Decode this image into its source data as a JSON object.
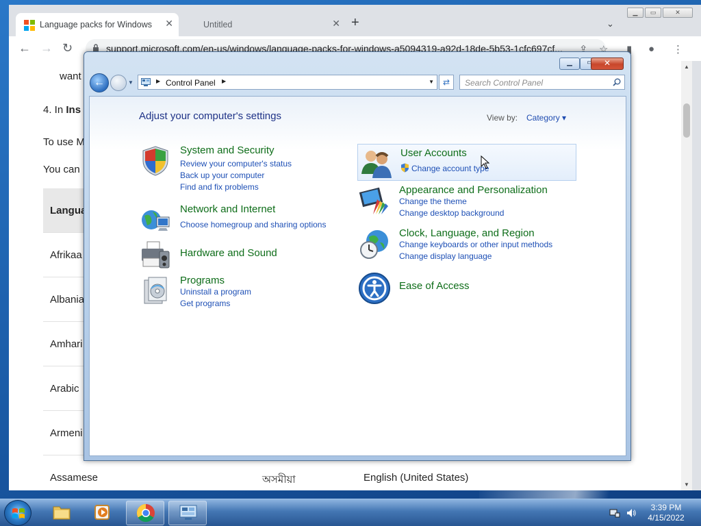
{
  "browser": {
    "tabs": [
      {
        "title": "Language packs for Windows",
        "close": "✕"
      },
      {
        "title": "Untitled",
        "close": "✕"
      }
    ],
    "new_tab": "+",
    "tab_search": "⌄",
    "url": "support.microsoft.com/en-us/windows/language-packs-for-windows-a5094319-a92d-18de-5b53-1cfc697cf...",
    "nav": {
      "back": "←",
      "forward": "→",
      "reload": "↻"
    },
    "page": {
      "line1": "want",
      "line2_prefix": "4.  In ",
      "line2_bold": "Ins",
      "line3": "To use M",
      "line4": "You can",
      "table_header": "Langua",
      "rows": [
        {
          "language": "Afrikaa",
          "native": "",
          "base": ""
        },
        {
          "language": "Albania",
          "native": "",
          "base": ""
        },
        {
          "language": "Amhari",
          "native": "",
          "base": ""
        },
        {
          "language": "Arabic",
          "native": "",
          "base": ""
        },
        {
          "language": "Armeni",
          "native": "",
          "base": ""
        },
        {
          "language": "Assamese",
          "native": "অসমীয়া",
          "base": "English (United States)"
        }
      ]
    }
  },
  "control_panel": {
    "breadcrumb": "Control Panel",
    "search_placeholder": "Search Control Panel",
    "heading": "Adjust your computer's settings",
    "view_by_label": "View by:",
    "view_by_value": "Category ▾",
    "categories": [
      {
        "title": "System and Security",
        "links": [
          "Review your computer's status",
          "Back up your computer",
          "Find and fix problems"
        ],
        "icon": "shield-icon"
      },
      {
        "title": "Network and Internet",
        "links": [
          "Choose homegroup and sharing options"
        ],
        "icon": "network-icon"
      },
      {
        "title": "Hardware and Sound",
        "links": [],
        "icon": "printer-icon"
      },
      {
        "title": "Programs",
        "links": [
          "Uninstall a program",
          "Get programs"
        ],
        "icon": "programs-icon"
      },
      {
        "title": "User Accounts",
        "links": [
          "Change account type"
        ],
        "icon": "users-icon"
      },
      {
        "title": "Appearance and Personalization",
        "links": [
          "Change the theme",
          "Change desktop background"
        ],
        "icon": "appearance-icon"
      },
      {
        "title": "Clock, Language, and Region",
        "links": [
          "Change keyboards or other input methods",
          "Change display language"
        ],
        "icon": "globe-clock-icon"
      },
      {
        "title": "Ease of Access",
        "links": [],
        "icon": "ease-of-access-icon"
      }
    ]
  },
  "taskbar": {
    "time": "3:39 PM",
    "date": "4/15/2022"
  },
  "colors": {
    "category_title": "#0e6d19",
    "link": "#1d4fb5",
    "heading": "#1e3287"
  }
}
